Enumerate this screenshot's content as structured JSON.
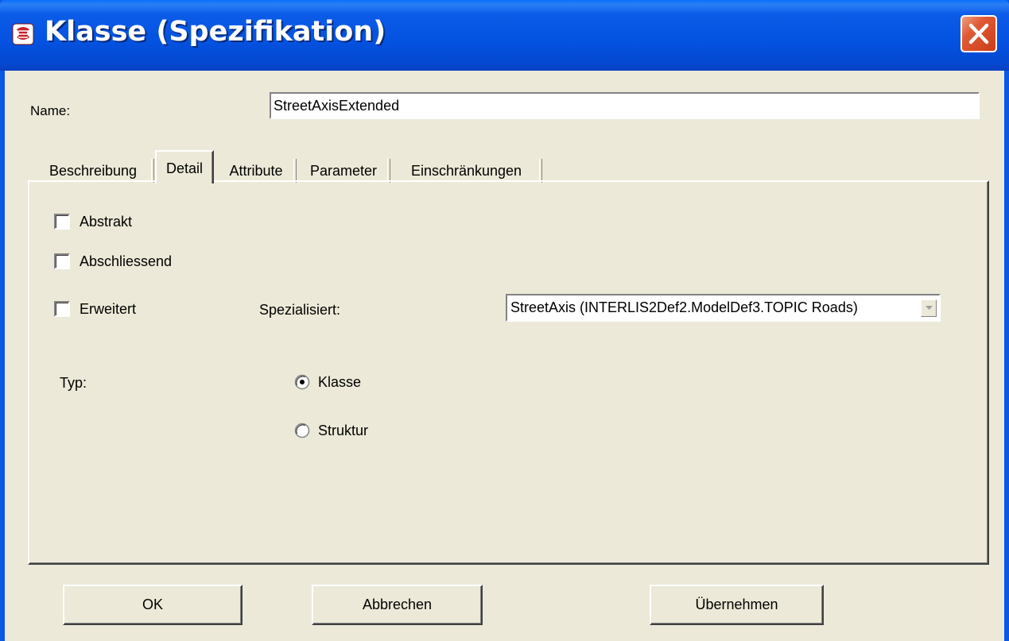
{
  "window": {
    "title": "Klasse (Spezifikation)"
  },
  "name_field": {
    "label": "Name:",
    "value": "StreetAxisExtended"
  },
  "tabs": [
    {
      "label": "Beschreibung",
      "active": false
    },
    {
      "label": "Detail",
      "active": true
    },
    {
      "label": "Attribute",
      "active": false
    },
    {
      "label": "Parameter",
      "active": false
    },
    {
      "label": "Einschränkungen",
      "active": false
    }
  ],
  "detail": {
    "checkboxes": [
      {
        "label": "Abstrakt",
        "checked": false
      },
      {
        "label": "Abschliessend",
        "checked": false
      },
      {
        "label": "Erweitert",
        "checked": false
      }
    ],
    "spezialisiert": {
      "label": "Spezialisiert:",
      "value": "StreetAxis (INTERLIS2Def2.ModelDef3.TOPIC Roads)"
    },
    "typ": {
      "label": "Typ:",
      "options": [
        {
          "label": "Klasse",
          "selected": true
        },
        {
          "label": "Struktur",
          "selected": false
        }
      ]
    }
  },
  "buttons": {
    "ok": "OK",
    "cancel": "Abbrechen",
    "apply": "Übernehmen"
  }
}
